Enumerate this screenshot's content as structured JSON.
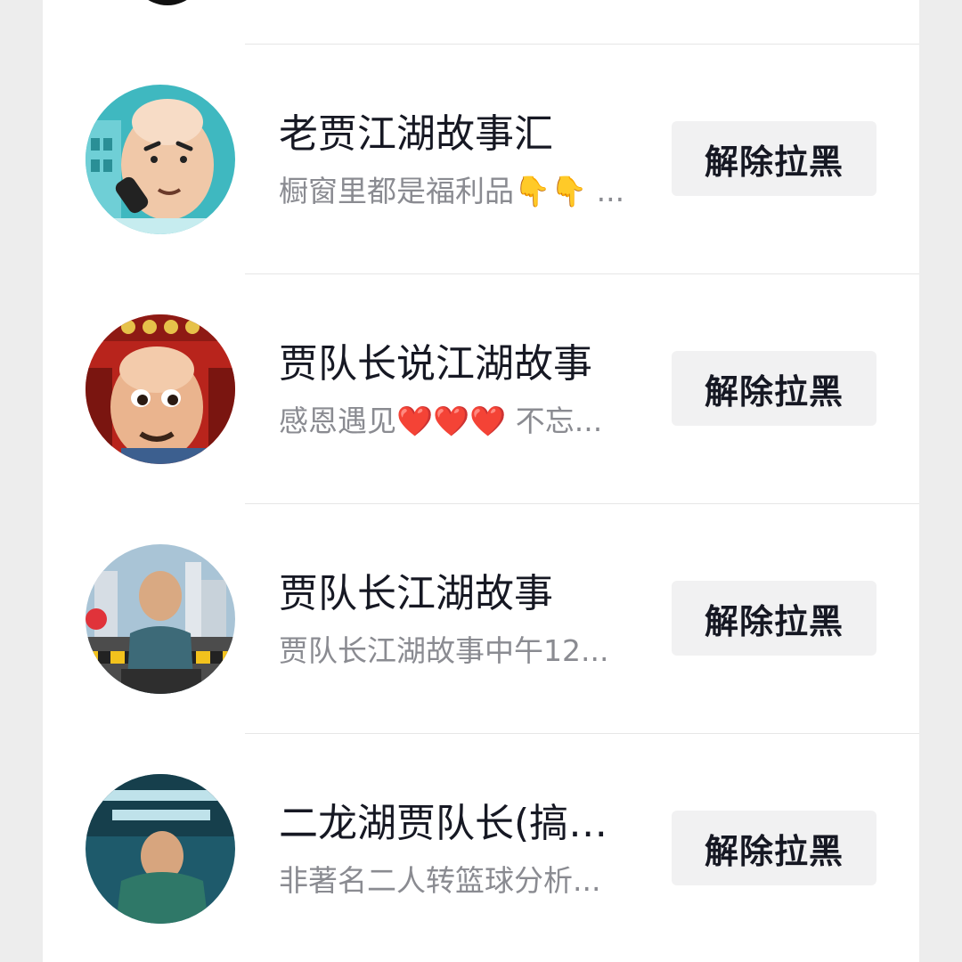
{
  "blocked_list": {
    "items": [
      {
        "name": "老贾江湖故事汇",
        "bio": "橱窗里都是福利品👇👇 ...",
        "button_label": "解除拉黑"
      },
      {
        "name": "贾队长说江湖故事",
        "bio": "感恩遇见❤️❤️❤️ 不忘...",
        "button_label": "解除拉黑"
      },
      {
        "name": "贾队长江湖故事",
        "bio": "贾队长江湖故事中午12...",
        "button_label": "解除拉黑"
      },
      {
        "name": "二龙湖贾队长(搞笑...",
        "bio": "非著名二人转篮球分析...",
        "button_label": "解除拉黑"
      }
    ]
  },
  "colors": {
    "page_background": "#ededed",
    "panel_background": "#ffffff",
    "name_text": "#161823",
    "bio_text": "#8a8b91",
    "button_background": "#f1f1f2"
  }
}
